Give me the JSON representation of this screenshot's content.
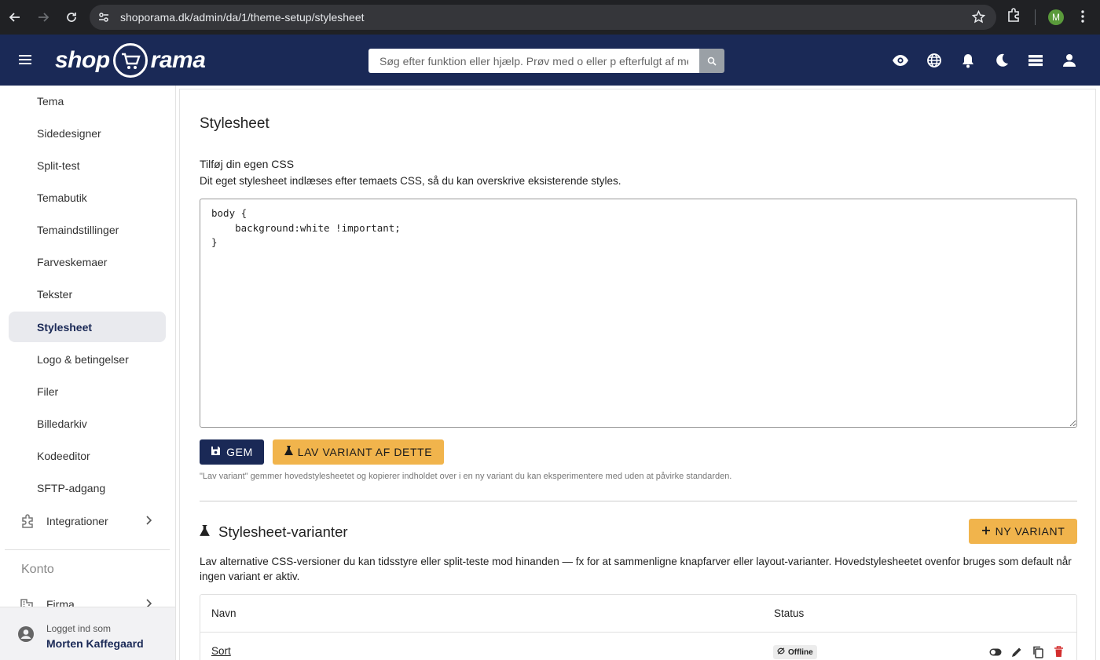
{
  "browser": {
    "url": "shoporama.dk/admin/da/1/theme-setup/stylesheet",
    "profile_initial": "M"
  },
  "header": {
    "logo_left": "shop",
    "logo_right": "rama",
    "search_placeholder": "Søg efter funktion eller hjælp. Prøv med o eller p efterfulgt af mellemrum",
    "icons": [
      "eye-icon",
      "globe-icon",
      "bell-icon",
      "moon-icon",
      "stack-icon",
      "person-icon"
    ]
  },
  "sidebar": {
    "items": [
      {
        "label": "Tema"
      },
      {
        "label": "Sidedesigner"
      },
      {
        "label": "Split-test"
      },
      {
        "label": "Temabutik"
      },
      {
        "label": "Temaindstillinger"
      },
      {
        "label": "Farveskemaer"
      },
      {
        "label": "Tekster"
      },
      {
        "label": "Stylesheet",
        "active": true
      },
      {
        "label": "Logo & betingelser"
      },
      {
        "label": "Filer"
      },
      {
        "label": "Billedarkiv"
      },
      {
        "label": "Kodeeditor"
      },
      {
        "label": "SFTP-adgang"
      }
    ],
    "integrations_label": "Integrationer",
    "account_heading": "Konto",
    "company_label": "Firma",
    "logged_in_label": "Logget ind som",
    "user_name": "Morten Kaffegaard"
  },
  "main": {
    "title": "Stylesheet",
    "intro_heading": "Tilføj din egen CSS",
    "intro_text": "Dit eget stylesheet indlæses efter temaets CSS, så du kan overskrive eksisterende styles.",
    "css_code": "body {\n    background:white !important;\n}",
    "save_label": "GEM",
    "variant_label": "LAV VARIANT AF DETTE",
    "hint": "\"Lav variant\" gemmer hovedstylesheetet og kopierer indholdet over i en ny variant du kan eksperimentere med uden at påvirke standarden.",
    "variants_title": "Stylesheet-varianter",
    "new_variant_label": "NY VARIANT",
    "variants_desc": "Lav alternative CSS-versioner du kan tidsstyre eller split-teste mod hinanden — fx for at sammenligne knapfarver eller layout-varianter. Hovedstylesheetet ovenfor bruges som default når ingen variant er aktiv.",
    "table": {
      "col_name": "Navn",
      "col_status": "Status",
      "rows": [
        {
          "name": "Sort",
          "status": "Offline"
        }
      ]
    }
  },
  "colors": {
    "header_bg": "#1a2956",
    "accent_yellow": "#f1b44c",
    "delete_red": "#d32f2f"
  }
}
